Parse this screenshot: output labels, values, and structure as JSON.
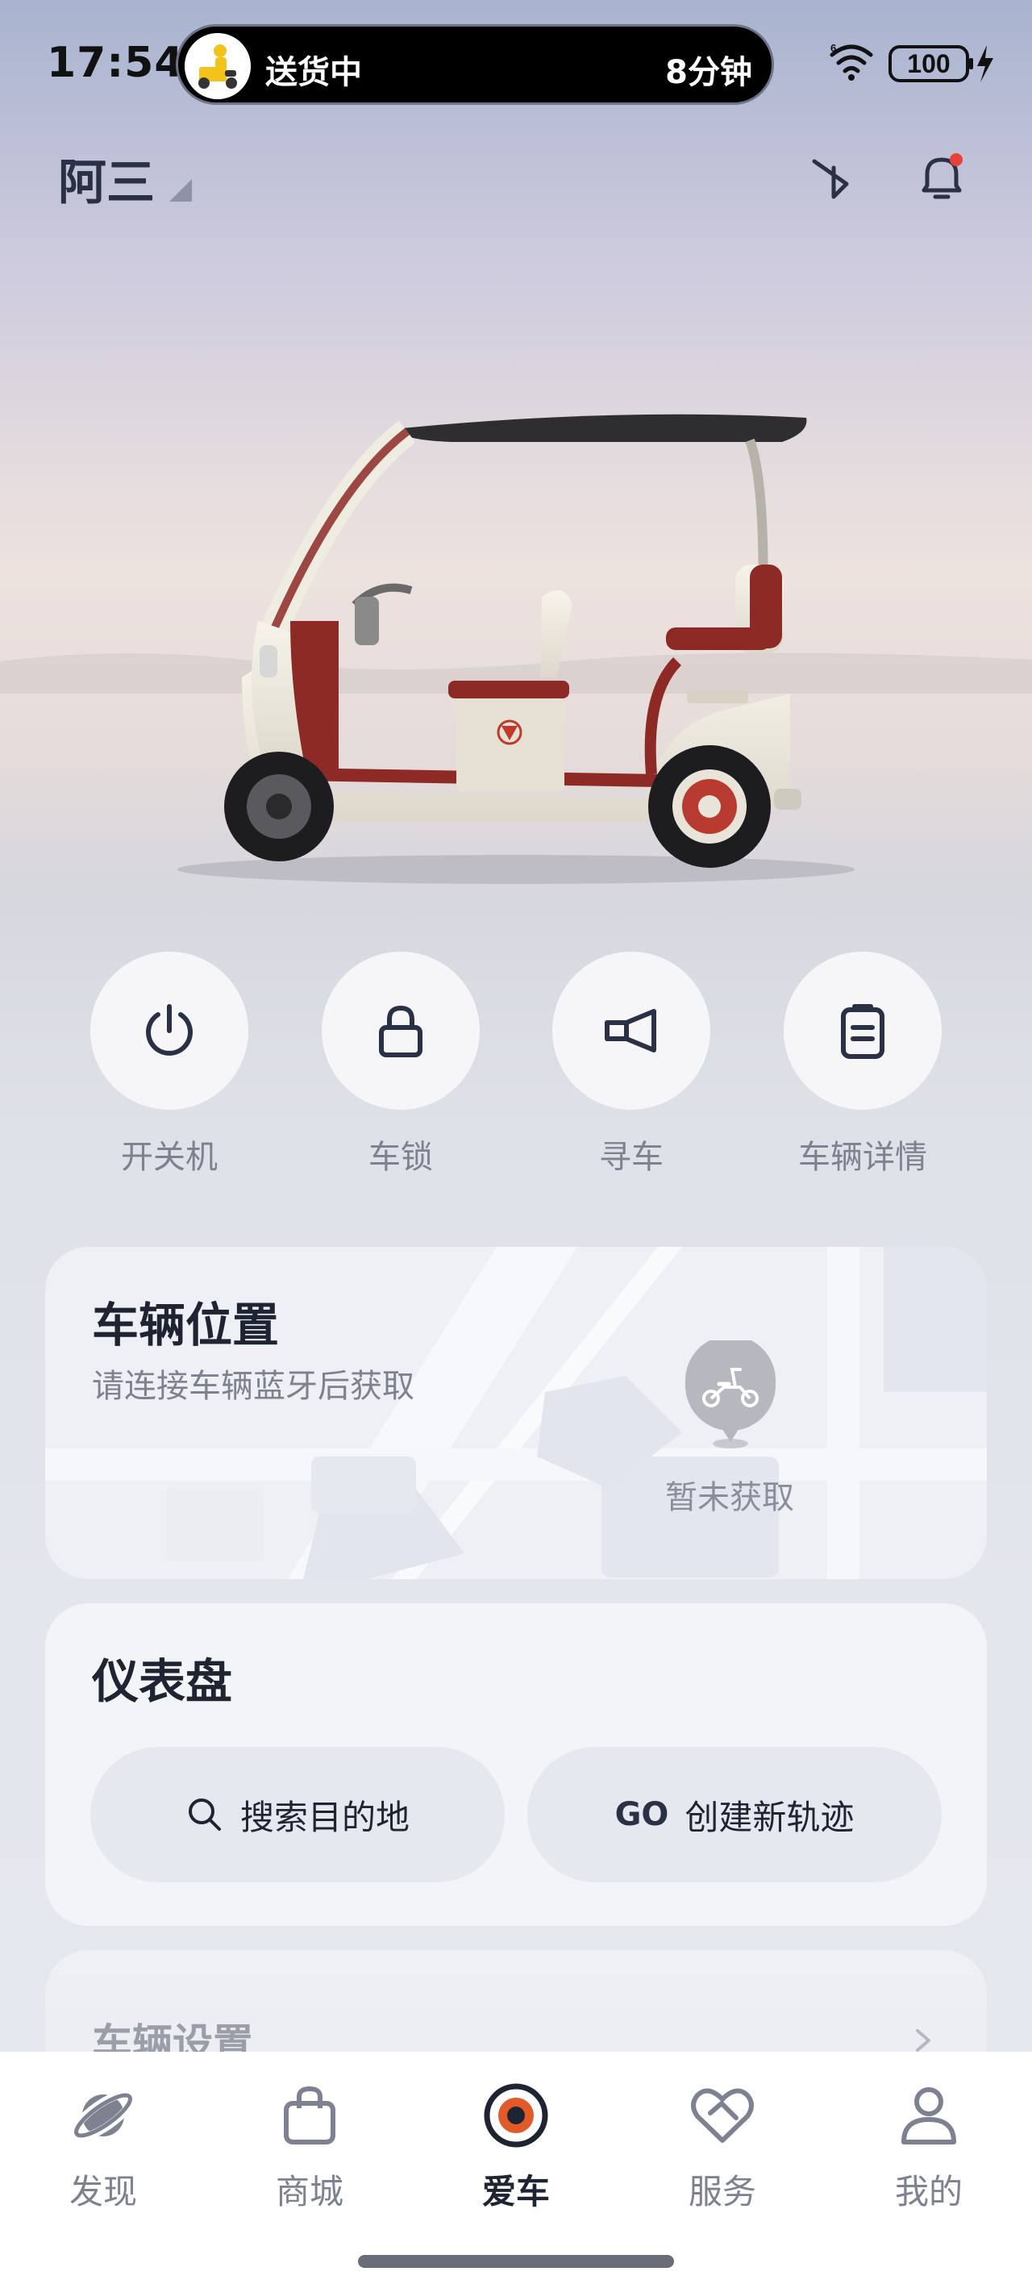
{
  "status_bar": {
    "time": "17:54",
    "live_activity": {
      "text": "送货中",
      "eta": "8分钟"
    },
    "battery": "100"
  },
  "header": {
    "user_name": "阿三",
    "icons": [
      "bluetooth-icon",
      "bell-icon"
    ]
  },
  "actions": [
    {
      "label": "开关机",
      "icon": "power-icon"
    },
    {
      "label": "车锁",
      "icon": "lock-icon"
    },
    {
      "label": "寻车",
      "icon": "horn-icon"
    },
    {
      "label": "车辆详情",
      "icon": "clipboard-icon"
    }
  ],
  "location_card": {
    "title": "车辆位置",
    "subtitle": "请连接车辆蓝牙后获取",
    "pin_label": "暂未获取"
  },
  "dashboard_card": {
    "title": "仪表盘",
    "search_label": "搜索目的地",
    "track_prefix": "GO",
    "track_label": "创建新轨迹"
  },
  "settings_card": {
    "title": "车辆设置"
  },
  "tabbar": [
    {
      "label": "发现",
      "icon": "planet-icon",
      "active": false
    },
    {
      "label": "商城",
      "icon": "bag-icon",
      "active": false
    },
    {
      "label": "爱车",
      "icon": "target-icon",
      "active": true
    },
    {
      "label": "服务",
      "icon": "heart-handshake-icon",
      "active": false
    },
    {
      "label": "我的",
      "icon": "person-icon",
      "active": false
    }
  ],
  "colors": {
    "accent": "#e35a2a",
    "notification_dot": "#e8413a",
    "vehicle_body": "#eeeadf",
    "vehicle_trim": "#8e2a26"
  }
}
